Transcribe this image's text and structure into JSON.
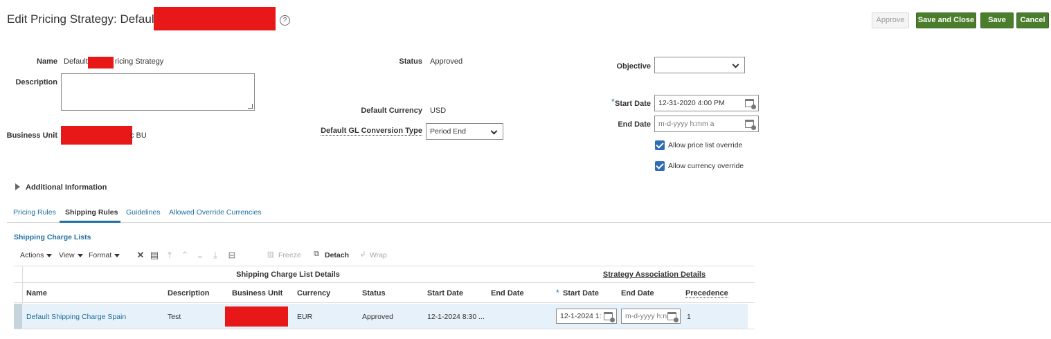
{
  "header": {
    "title": "Edit Pricing Strategy: Defaul",
    "help_glyph": "?",
    "buttons": {
      "approve": "Approve",
      "save_and_close": "Save and Close",
      "save": "Save",
      "cancel": "Cancel"
    }
  },
  "form": {
    "name_label": "Name",
    "name_value_start": "Default",
    "name_value_end": "ricing Strategy",
    "description_label": "Description",
    "description_value": "",
    "business_unit_label": "Business Unit",
    "business_unit_value_end": "c BU",
    "status_label": "Status",
    "status_value": "Approved",
    "currency_label": "Default Currency",
    "currency_value": "USD",
    "gl_label": "Default GL Conversion Type",
    "gl_value": "Period End",
    "objective_label": "Objective",
    "objective_value": "",
    "required_marker": "*",
    "start_date_label": "Start Date",
    "start_date_value": "12-31-2020 4:00 PM",
    "end_date_label": "End Date",
    "end_date_placeholder": "m-d-yyyy h:mm a",
    "allow_price_list_label": "Allow price list override",
    "allow_price_list_checked": true,
    "allow_currency_label": "Allow currency override",
    "allow_currency_checked": true
  },
  "additional_info_label": "Additional Information",
  "tabs": [
    {
      "label": "Pricing Rules",
      "active": false
    },
    {
      "label": "Shipping Rules",
      "active": true
    },
    {
      "label": "Guidelines",
      "active": false
    },
    {
      "label": "Allowed Override Currencies",
      "active": false
    }
  ],
  "section_title": "Shipping Charge Lists",
  "toolbar": {
    "actions": "Actions",
    "view": "View",
    "format": "Format",
    "freeze": "Freeze",
    "detach": "Detach",
    "wrap": "Wrap"
  },
  "table": {
    "group_headers": {
      "details": "Shipping Charge List Details",
      "association": "Strategy Association Details"
    },
    "columns": {
      "name": "Name",
      "description": "Description",
      "business_unit": "Business Unit",
      "currency": "Currency",
      "status": "Status",
      "start_date": "Start Date",
      "end_date": "End Date",
      "assoc_start_date": "Start Date",
      "assoc_end_date": "End Date",
      "precedence": "Precedence"
    },
    "rows": [
      {
        "name": "Default Shipping Charge Spain",
        "description": "Test",
        "business_unit": "",
        "currency": "EUR",
        "status": "Approved",
        "start_date": "12-1-2024 8:30 ...",
        "end_date": "",
        "assoc_start_date": "12-1-2024 1:",
        "assoc_end_date_placeholder": "m-d-yyyy h:n",
        "precedence": "1"
      }
    ]
  },
  "colors": {
    "accent": "#1e6fa0",
    "button_green": "#4b7e2c",
    "redaction": "#e81818",
    "selected_row": "#e7f1f9"
  }
}
